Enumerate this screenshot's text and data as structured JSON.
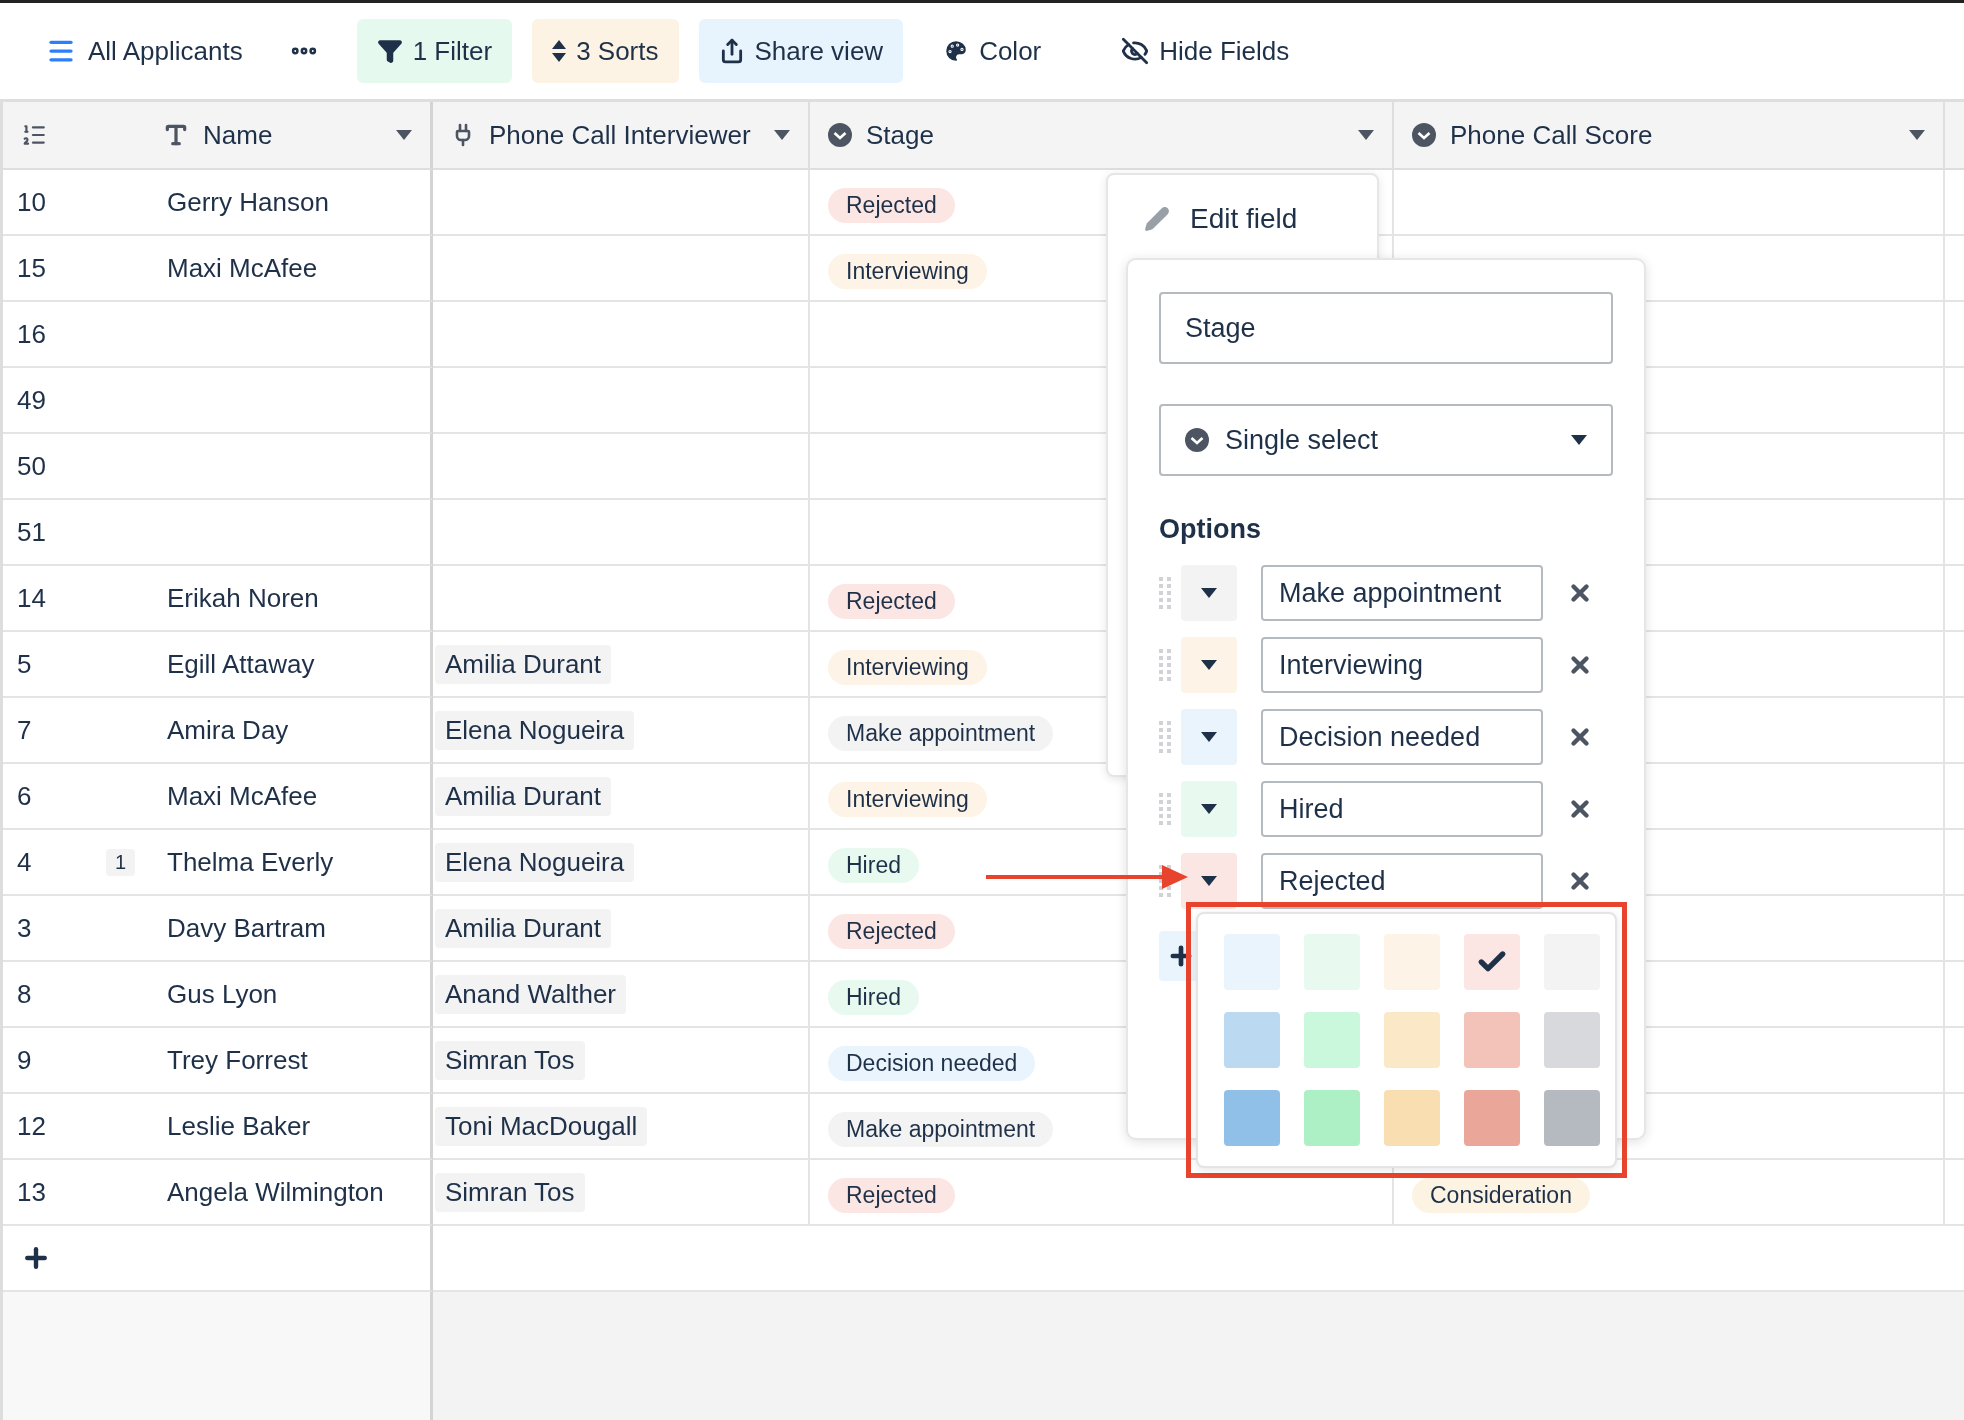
{
  "toolbar": {
    "view_name": "All Applicants",
    "buttons": [
      {
        "label": "1 Filter",
        "kind": "filter",
        "color": "#e6f9ee"
      },
      {
        "label": "3 Sorts",
        "kind": "sort",
        "color": "#fdf3e4"
      },
      {
        "label": "Share view",
        "kind": "share",
        "color": "#e8f4fd"
      },
      {
        "label": "Color",
        "kind": "color"
      },
      {
        "label": "Hide Fields",
        "kind": "hide"
      }
    ]
  },
  "table": {
    "columns": [
      {
        "label": "Name",
        "kind": "text"
      },
      {
        "label": "Phone Call Interviewer",
        "kind": "link"
      },
      {
        "label": "Stage",
        "kind": "select"
      },
      {
        "label": "Phone Call Score",
        "kind": "select"
      }
    ],
    "rows": [
      {
        "number": "10",
        "name": "Gerry Hanson",
        "stage": {
          "label": "Rejected",
          "color": "#fbe6e4"
        }
      },
      {
        "number": "15",
        "name": "Maxi McAfee",
        "stage": {
          "label": "Interviewing",
          "color": "#fdf3e6"
        }
      },
      {
        "number": "16"
      },
      {
        "number": "49"
      },
      {
        "number": "50"
      },
      {
        "number": "51"
      },
      {
        "number": "14",
        "name": "Erikah Noren",
        "stage": {
          "label": "Rejected",
          "color": "#fbe6e4"
        }
      },
      {
        "number": "5",
        "name": "Egill Attaway",
        "interviewer": "Amilia Durant",
        "stage": {
          "label": "Interviewing",
          "color": "#fdf3e6"
        }
      },
      {
        "number": "7",
        "name": "Amira Day",
        "interviewer": "Elena Nogueira",
        "stage": {
          "label": "Make appointment",
          "color": "#f3f3f3"
        }
      },
      {
        "number": "6",
        "name": "Maxi McAfee",
        "interviewer": "Amilia Durant",
        "stage": {
          "label": "Interviewing",
          "color": "#fdf3e6"
        }
      },
      {
        "number": "4",
        "comments": "1",
        "name": "Thelma Everly",
        "interviewer": "Elena Nogueira",
        "stage": {
          "label": "Hired",
          "color": "#e8faf0"
        }
      },
      {
        "number": "3",
        "name": "Davy Bartram",
        "interviewer": "Amilia Durant",
        "stage": {
          "label": "Rejected",
          "color": "#fbe6e4"
        }
      },
      {
        "number": "8",
        "name": "Gus Lyon",
        "interviewer": "Anand Walther",
        "stage": {
          "label": "Hired",
          "color": "#e8faf0"
        }
      },
      {
        "number": "9",
        "name": "Trey Forrest",
        "interviewer": "Simran Tos",
        "stage": {
          "label": "Decision needed",
          "color": "#eaf4fd"
        }
      },
      {
        "number": "12",
        "name": "Leslie Baker",
        "interviewer": "Toni MacDougall",
        "stage": {
          "label": "Make appointment",
          "color": "#f3f3f3"
        }
      },
      {
        "number": "13",
        "name": "Angela Wilmington",
        "interviewer": "Simran Tos",
        "stage": {
          "label": "Rejected",
          "color": "#fbe6e4"
        },
        "score": {
          "label": "Consideration",
          "color": "#fdf3e2"
        }
      }
    ]
  },
  "edit_field": {
    "title": "Edit field",
    "field_name": "Stage",
    "field_type": "Single select",
    "options_heading": "Options",
    "options": [
      {
        "label": "Make appointment",
        "color": "#f3f3f3",
        "picker_open": false
      },
      {
        "label": "Interviewing",
        "color": "#fdf3e6",
        "picker_open": false
      },
      {
        "label": "Decision needed",
        "color": "#eaf4fd",
        "picker_open": false
      },
      {
        "label": "Hired",
        "color": "#e8faf0",
        "picker_open": false
      },
      {
        "label": "Rejected",
        "color": "#fbe6e4",
        "picker_open": true
      }
    ],
    "swatches": [
      {
        "color": "#eaf4fd",
        "selected": false
      },
      {
        "color": "#e8faf0",
        "selected": false
      },
      {
        "color": "#fdf3e6",
        "selected": false
      },
      {
        "color": "#fbe6e4",
        "selected": true
      },
      {
        "color": "#f3f3f3",
        "selected": false
      },
      {
        "color": "#bcd9f2",
        "selected": false
      },
      {
        "color": "#c9f8dc",
        "selected": false
      },
      {
        "color": "#fae8c7",
        "selected": false
      },
      {
        "color": "#f3c2b9",
        "selected": false
      },
      {
        "color": "#d8d9dd",
        "selected": false
      },
      {
        "color": "#90c0e8",
        "selected": false
      },
      {
        "color": "#aef0c6",
        "selected": false
      },
      {
        "color": "#f8deb0",
        "selected": false
      },
      {
        "color": "#eaa698",
        "selected": false
      },
      {
        "color": "#b5b9c0",
        "selected": false
      }
    ]
  }
}
